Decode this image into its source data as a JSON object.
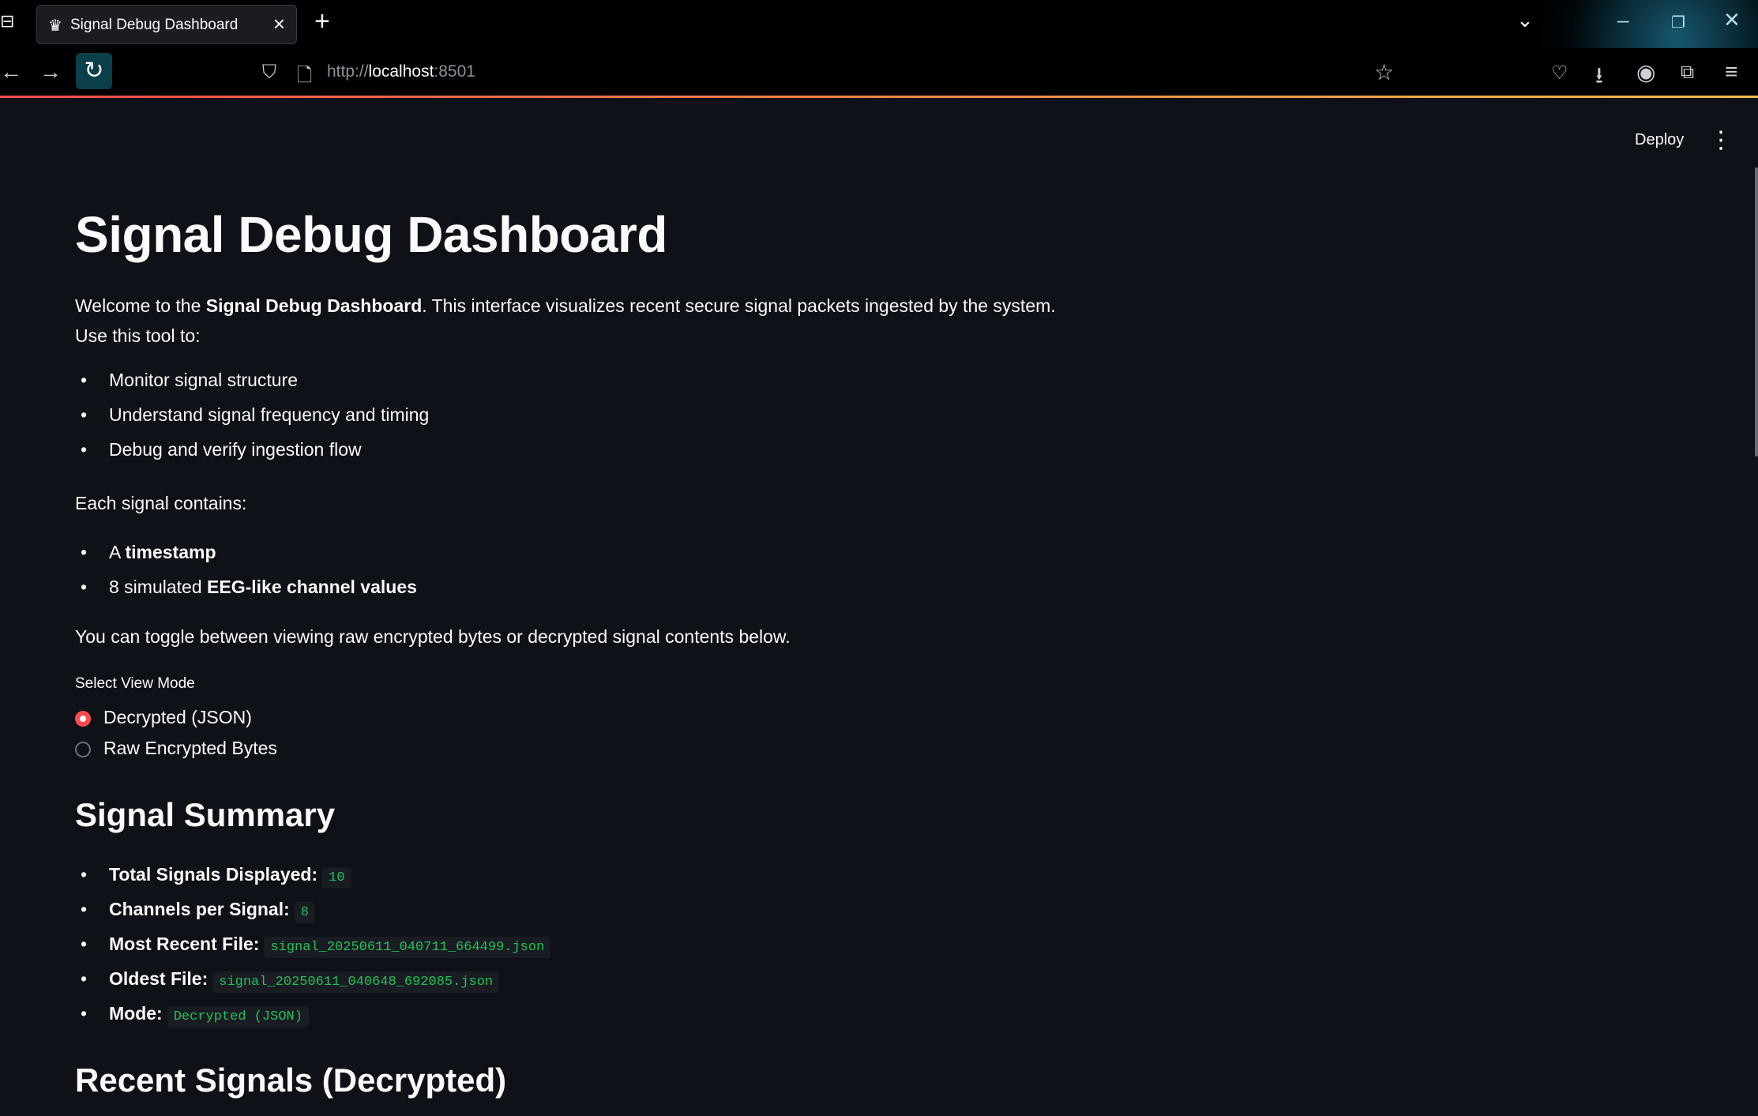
{
  "browser": {
    "tab_title": "Signal Debug Dashboard",
    "url_prefix": "http://",
    "url_host": "localhost",
    "url_port": ":8501"
  },
  "toolbar": {
    "deploy_label": "Deploy"
  },
  "page": {
    "title": "Signal Debug Dashboard",
    "intro_prefix": "Welcome to the ",
    "intro_bold": "Signal Debug Dashboard",
    "intro_suffix": ". This interface visualizes recent secure signal packets ingested by the system.",
    "use_tool": "Use this tool to:",
    "uses": [
      "Monitor signal structure",
      "Understand signal frequency and timing",
      "Debug and verify ingestion flow"
    ],
    "each_signal": "Each signal contains:",
    "contains": [
      {
        "prefix": "A ",
        "bold": "timestamp"
      },
      {
        "prefix": "8 simulated ",
        "bold": "EEG-like channel values"
      }
    ],
    "toggle_text": "You can toggle between viewing raw encrypted bytes or decrypted signal contents below.",
    "view_mode": {
      "label": "Select View Mode",
      "options": [
        "Decrypted (JSON)",
        "Raw Encrypted Bytes"
      ],
      "selected": 0
    },
    "summary_heading": "Signal Summary",
    "summary": [
      {
        "label": "Total Signals Displayed:",
        "value": "10"
      },
      {
        "label": "Channels per Signal:",
        "value": "8"
      },
      {
        "label": "Most Recent File:",
        "value": "signal_20250611_040711_664499.json"
      },
      {
        "label": "Oldest File:",
        "value": "signal_20250611_040648_692085.json"
      },
      {
        "label": "Mode:",
        "value": "Decrypted (JSON)"
      }
    ],
    "recent_heading": "Recent Signals (Decrypted)"
  },
  "colors": {
    "accent": "#ff4b4b",
    "code_text": "#21c354",
    "background": "#0e1117"
  }
}
